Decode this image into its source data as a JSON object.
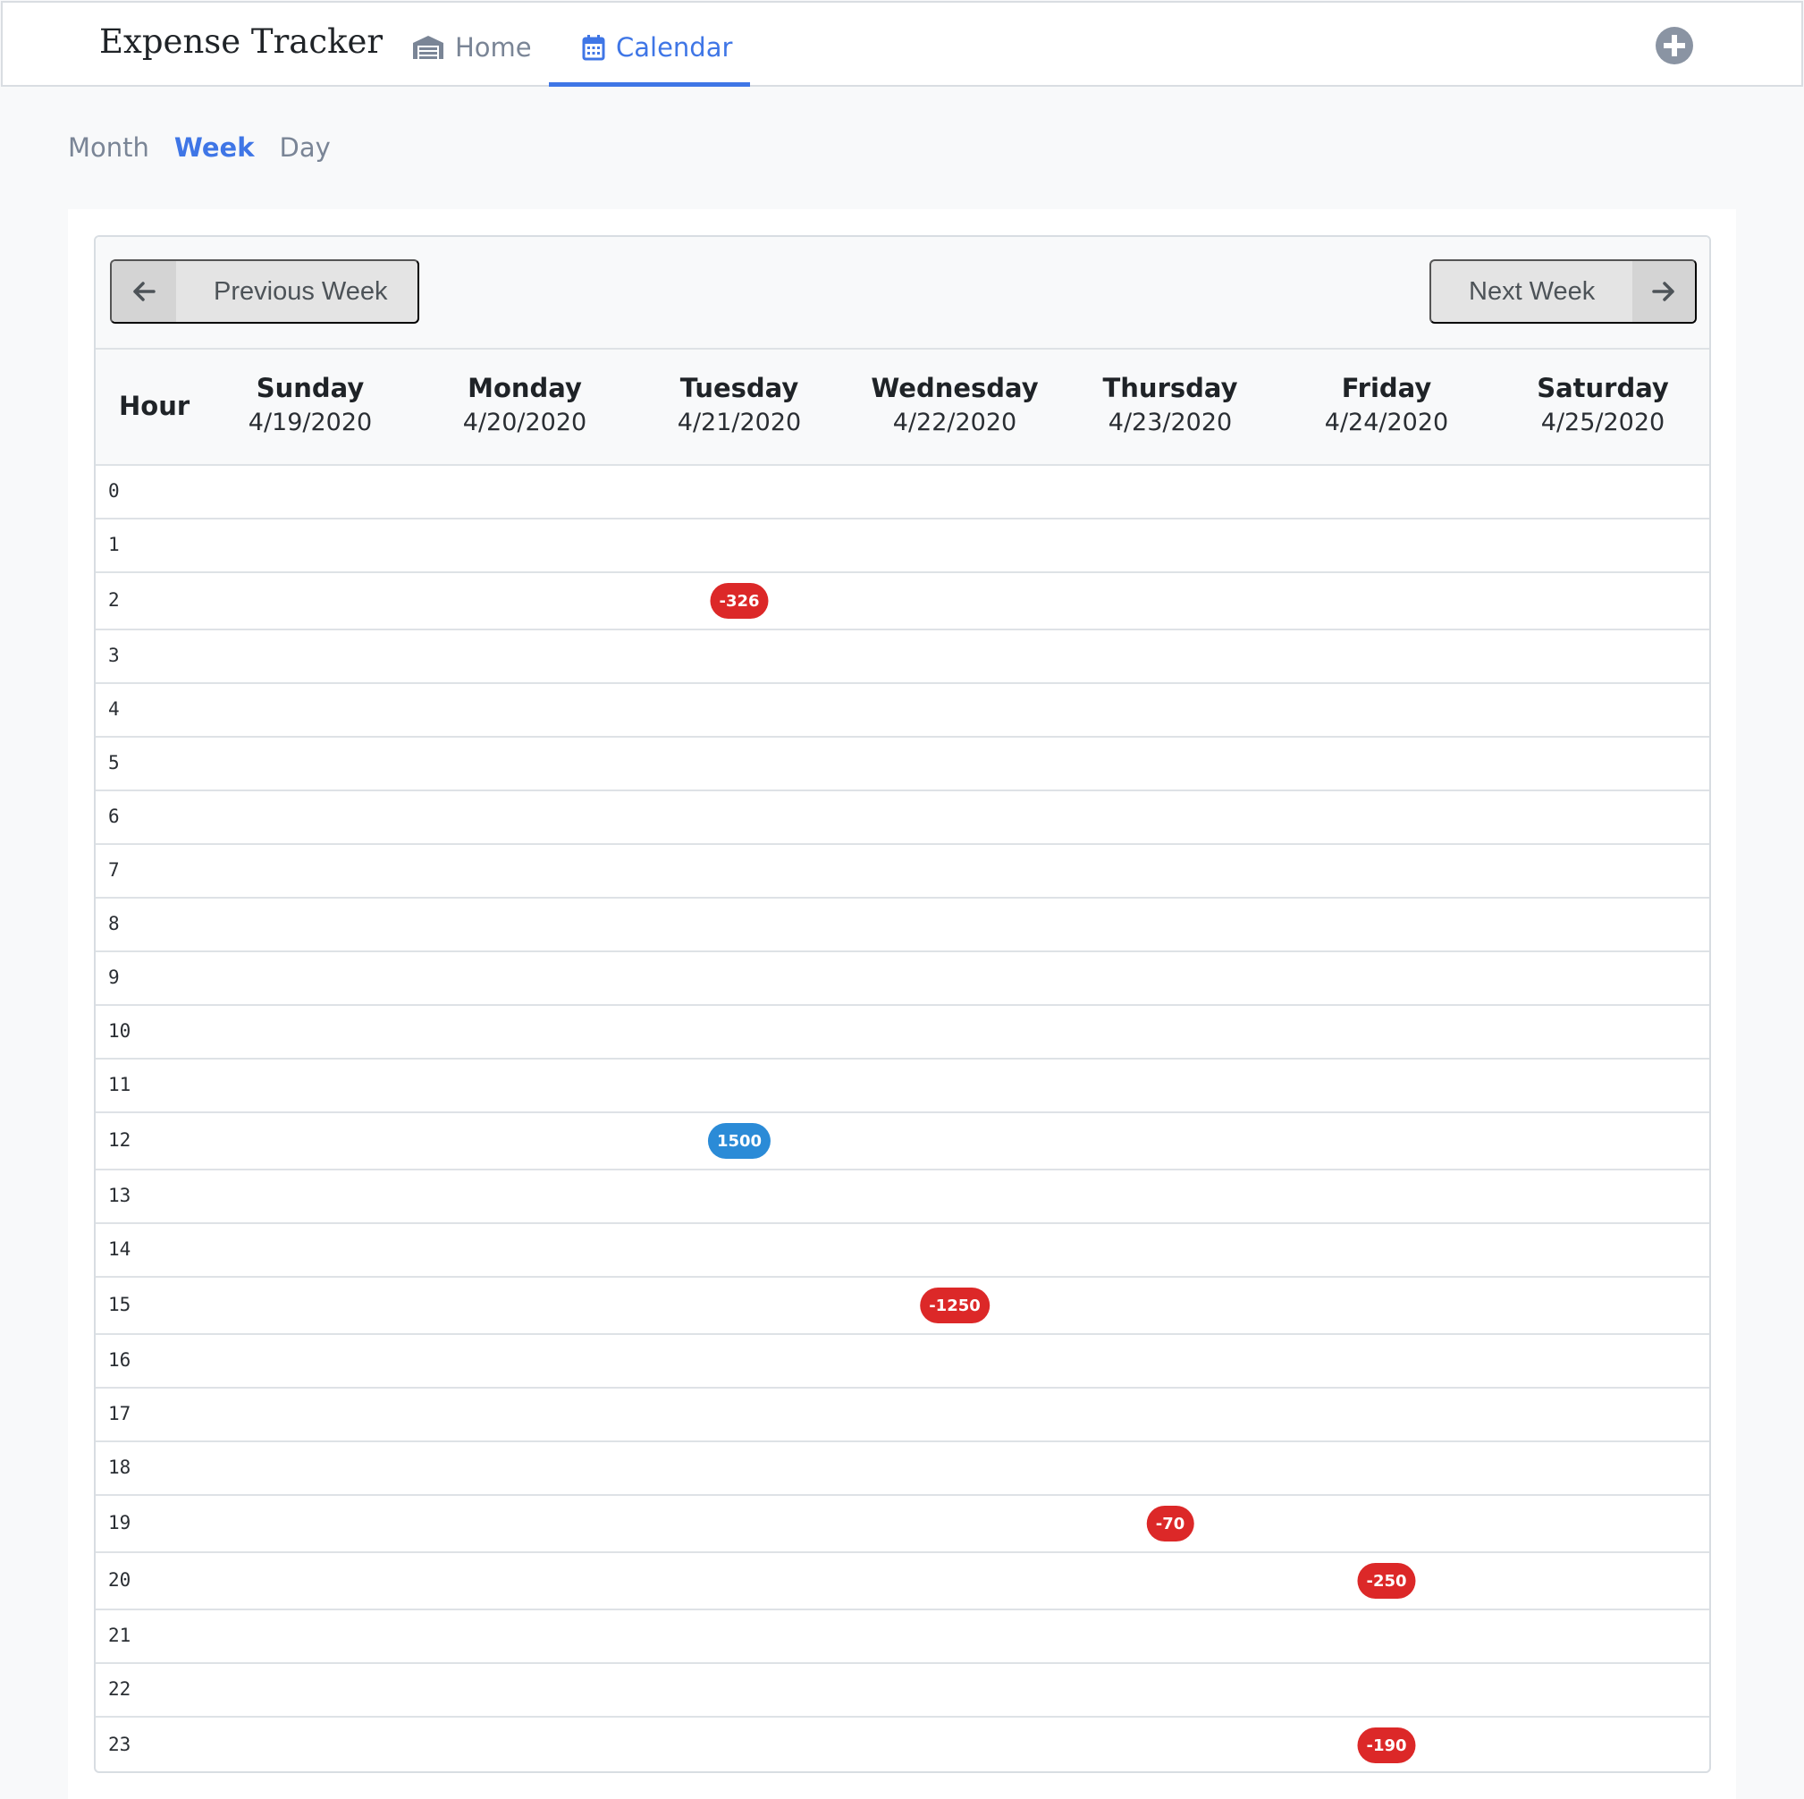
{
  "app": {
    "brand": "Expense Tracker",
    "nav": [
      {
        "label": "Home",
        "icon": "warehouse-icon",
        "active": false
      },
      {
        "label": "Calendar",
        "icon": "calendar-icon",
        "active": true
      }
    ],
    "add_icon": "plus-circle-icon"
  },
  "view_tabs": [
    {
      "label": "Month",
      "active": false
    },
    {
      "label": "Week",
      "active": true
    },
    {
      "label": "Day",
      "active": false
    }
  ],
  "calendar": {
    "prev_label": "Previous Week",
    "next_label": "Next Week",
    "hour_header": "Hour",
    "days": [
      {
        "name": "Sunday",
        "date": "4/19/2020"
      },
      {
        "name": "Monday",
        "date": "4/20/2020"
      },
      {
        "name": "Tuesday",
        "date": "4/21/2020"
      },
      {
        "name": "Wednesday",
        "date": "4/22/2020"
      },
      {
        "name": "Thursday",
        "date": "4/23/2020"
      },
      {
        "name": "Friday",
        "date": "4/24/2020"
      },
      {
        "name": "Saturday",
        "date": "4/25/2020"
      }
    ],
    "hours": [
      "0",
      "1",
      "2",
      "3",
      "4",
      "5",
      "6",
      "7",
      "8",
      "9",
      "10",
      "11",
      "12",
      "13",
      "14",
      "15",
      "16",
      "17",
      "18",
      "19",
      "20",
      "21",
      "22",
      "23"
    ],
    "entries": [
      {
        "day": 2,
        "hour": 2,
        "amount": "-326",
        "type": "expense"
      },
      {
        "day": 2,
        "hour": 12,
        "amount": "1500",
        "type": "income"
      },
      {
        "day": 3,
        "hour": 15,
        "amount": "-1250",
        "type": "expense"
      },
      {
        "day": 4,
        "hour": 19,
        "amount": "-70",
        "type": "expense"
      },
      {
        "day": 5,
        "hour": 20,
        "amount": "-250",
        "type": "expense"
      },
      {
        "day": 5,
        "hour": 23,
        "amount": "-190",
        "type": "expense"
      }
    ],
    "colors": {
      "expense": "#dc2828",
      "income": "#2b8bd7",
      "accent": "#3f76e6"
    }
  }
}
